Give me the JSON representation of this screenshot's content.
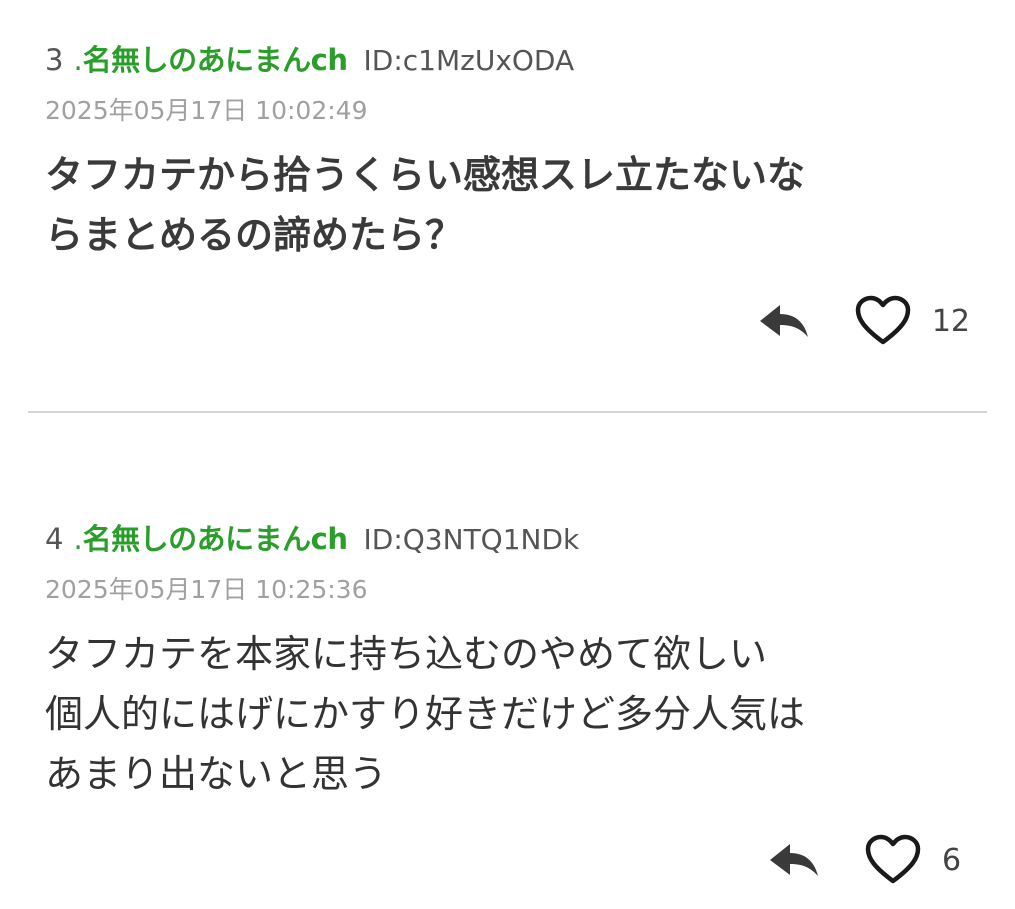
{
  "posts": [
    {
      "number": "3",
      "dot": ".",
      "name": "名無しのあにまんch",
      "id": "ID:c1MzUxODA",
      "date": "2025年05月17日 10:02:49",
      "body": "タフカテから拾うくらい感想スレ立たないな\nらまとめるの諦めたら？",
      "likes": "12",
      "reply_icon": "reply-icon",
      "like_icon": "heart-outline-icon"
    },
    {
      "number": "4",
      "dot": ".",
      "name": "名無しのあにまんch",
      "id": "ID:Q3NTQ1NDk",
      "date": "2025年05月17日 10:25:36",
      "body": "タフカテを本家に持ち込むのやめて欲しい\n個人的にはげにかすり好きだけど多分人気は\nあまり出ないと思う",
      "likes": "6",
      "reply_icon": "reply-icon",
      "like_icon": "heart-outline-icon"
    }
  ],
  "colors": {
    "name_green": "#2a9d2a",
    "date_gray": "#a0a0a0",
    "divider": "#d4d4d4"
  }
}
